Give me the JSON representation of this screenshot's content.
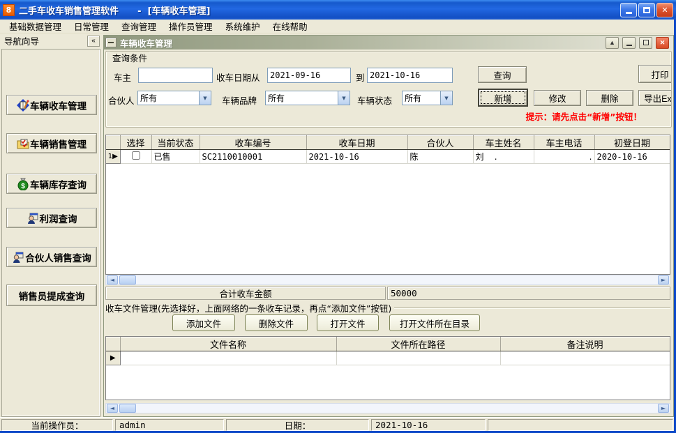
{
  "window": {
    "title": "二手车收车销售管理软件      -  [车辆收车管理]",
    "icon_glyph": "8"
  },
  "menu": {
    "items": [
      "基础数据管理",
      "日常管理",
      "查询管理",
      "操作员管理",
      "系统维护",
      "在线帮助"
    ]
  },
  "sidebar": {
    "header": "导航向导",
    "collapse_label": "«",
    "items": [
      {
        "label": "车辆收车管理",
        "icon": "notebook-pencil-icon"
      },
      {
        "label": "车辆销售管理",
        "icon": "folder-check-icon"
      },
      {
        "label": "车辆库存查询",
        "icon": "money-bag-icon"
      },
      {
        "label": "利润查询",
        "icon": "profit-person-icon"
      },
      {
        "label": "合伙人销售查询",
        "icon": "partner-person-icon"
      },
      {
        "label": "销售员提成查询",
        "icon": ""
      }
    ]
  },
  "child": {
    "title": "车辆收车管理",
    "query": {
      "group_title": "查询条件",
      "owner_label": "车主",
      "owner_value": "",
      "date_from_label": "收车日期从",
      "date_from": "2021-09-16",
      "date_to_label": "到",
      "date_to": "2021-10-16",
      "search_btn": "查询",
      "print_btn": "打印",
      "partner_label": "合伙人",
      "partner_value": "所有",
      "brand_label": "车辆品牌",
      "brand_value": "所有",
      "status_label": "车辆状态",
      "status_value": "所有",
      "add_btn": "新增",
      "edit_btn": "修改",
      "delete_btn": "删除",
      "export_btn": "导出Exc",
      "hint": "提示：请先点击“新增”按钮！"
    },
    "table": {
      "headers": [
        "选择",
        "当前状态",
        "收车编号",
        "收车日期",
        "合伙人",
        "车主姓名",
        "车主电话",
        "初登日期"
      ],
      "rows": [
        {
          "num": "1",
          "status": "已售",
          "code": "SC2110010001",
          "date": "2021-10-16",
          "partner": "陈",
          "owner": "刘    .",
          "phone": ".",
          "first_reg": "2020-10-16"
        }
      ]
    },
    "total": {
      "label": "合计收车金额",
      "value": "50000"
    },
    "files": {
      "group_title": "收车文件管理(先选择好，上面网络的一条收车记录，再点“添加文件”按钮)",
      "add_btn": "添加文件",
      "delete_btn": "删除文件",
      "open_btn": "打开文件",
      "open_dir_btn": "打开文件所在目录",
      "headers": [
        "文件名称",
        "文件所在路径",
        "备注说明"
      ]
    }
  },
  "statusbar": {
    "operator_label": "当前操作员：",
    "operator_value": "admin",
    "date_label": "日期：",
    "date_value": "2021-10-16"
  }
}
